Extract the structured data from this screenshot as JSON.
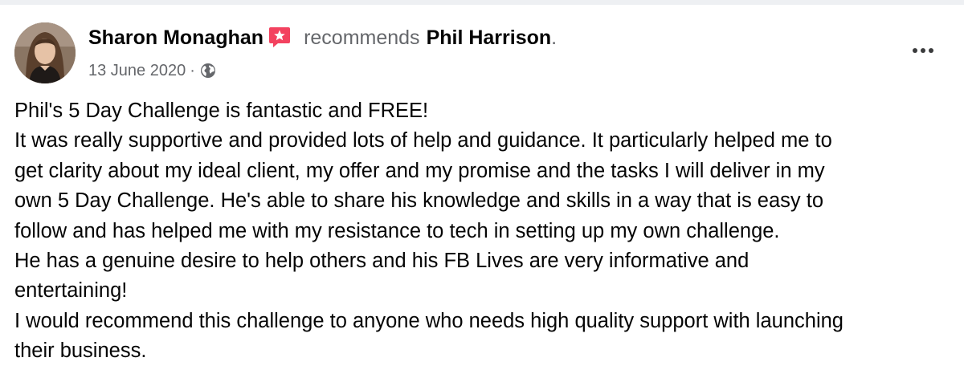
{
  "post": {
    "author": "Sharon Monaghan",
    "verb": "recommends",
    "target": "Phil Harrison",
    "period": ".",
    "date": "13 June 2020",
    "separator": "·",
    "audience_icon": "globe-icon",
    "recommend_icon": "recommendation-star-icon",
    "recommend_icon_color": "#f3425f",
    "more_icon": "more-options-icon",
    "body_lines": [
      "Phil's 5 Day Challenge is fantastic and FREE!",
      "It was really supportive and provided lots of help and guidance.  It particularly helped me to",
      "get clarity about my ideal client, my offer and my promise and the tasks I will deliver in my",
      "own 5 Day Challenge. He's able to share his knowledge and skills in a way that is easy to",
      "follow and has helped me with my resistance to tech in setting up my own challenge.",
      "He has a genuine desire to help others and his FB Lives are very informative and",
      "entertaining!",
      "I would recommend this challenge to anyone who needs high quality support with launching",
      "their business."
    ]
  }
}
